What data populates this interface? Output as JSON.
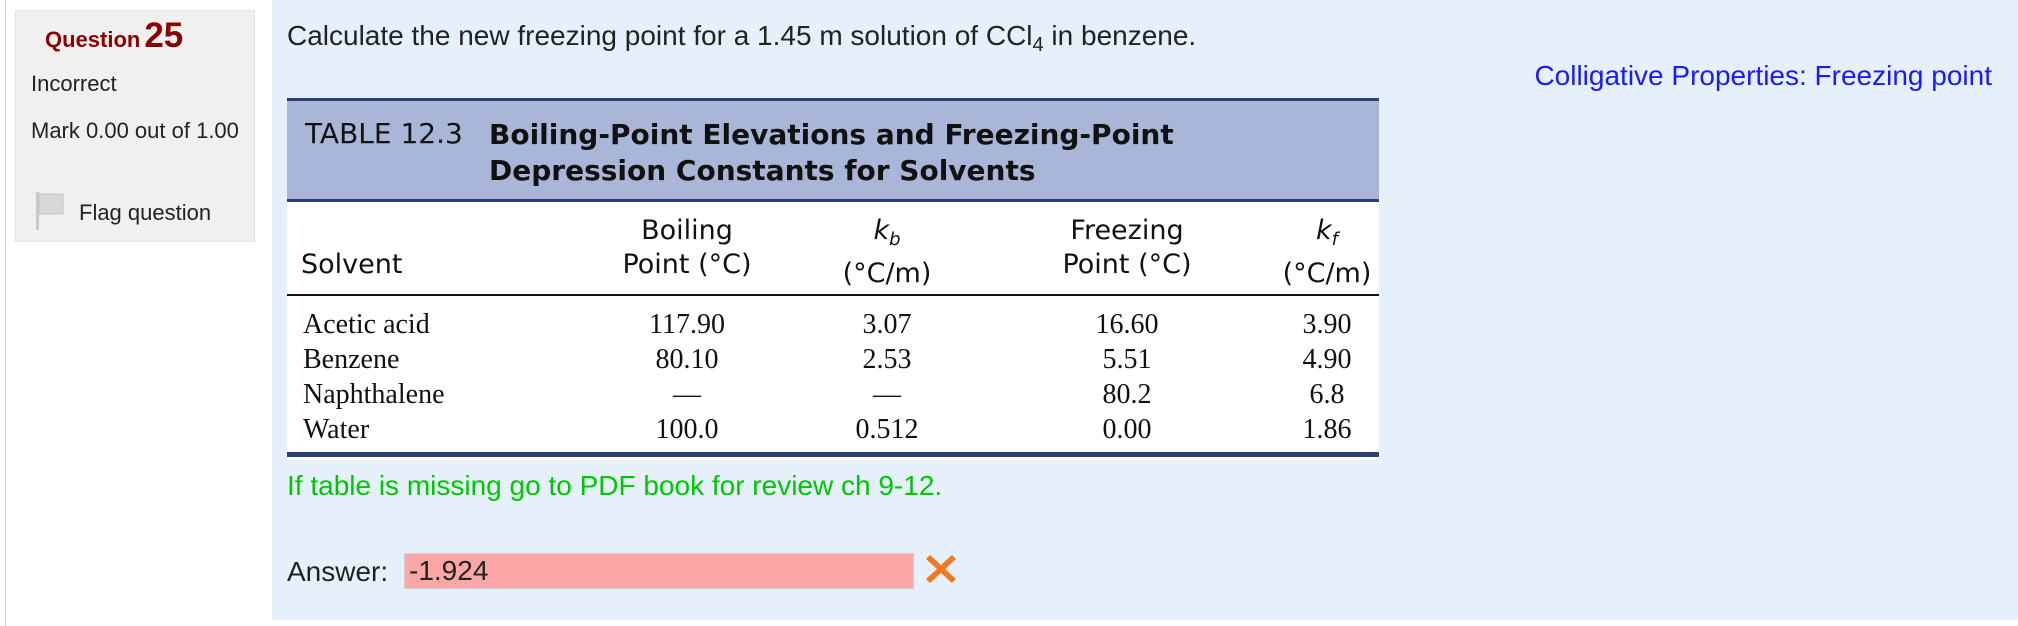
{
  "question_info": {
    "label": "Question",
    "number": "25",
    "state": "Incorrect",
    "grade": "Mark 0.00 out of 1.00",
    "flag_label": "Flag question"
  },
  "question": {
    "text_before": "Calculate the new freezing point for a 1.45 m solution of CCl",
    "subscript": "4",
    "text_after": " in benzene.",
    "topic_link": "Colligative Properties: Freezing point"
  },
  "textbook_table": {
    "number": "TABLE 12.3",
    "title": "Boiling-Point Elevations and Freezing-Point Depression Constants for Solvents",
    "headers": {
      "solvent": "Solvent",
      "bp_line1": "Boiling",
      "bp_line2": "Point (°C)",
      "kb_symbol": "k",
      "kb_sub": "b",
      "kb_unit": "(°C/m)",
      "fp_line1": "Freezing",
      "fp_line2": "Point (°C)",
      "kf_symbol": "k",
      "kf_sub": "f",
      "kf_unit": "(°C/m)"
    },
    "rows": [
      {
        "solvent": "Acetic acid",
        "bp": "117.90",
        "kb": "3.07",
        "fp": "16.60",
        "kf": "3.90"
      },
      {
        "solvent": "Benzene",
        "bp": "80.10",
        "kb": "2.53",
        "fp": "5.51",
        "kf": "4.90"
      },
      {
        "solvent": "Naphthalene",
        "bp": "—",
        "kb": "—",
        "fp": "80.2",
        "kf": "6.8"
      },
      {
        "solvent": "Water",
        "bp": "100.0",
        "kb": "0.512",
        "fp": "0.00",
        "kf": "1.86"
      }
    ]
  },
  "note": "If table is missing go to PDF book for review ch 9-12.",
  "answer": {
    "label": "Answer:",
    "value": "-1.924",
    "status_icon": "incorrect-x-icon"
  },
  "colors": {
    "link": "#1a1aff",
    "note": "#00c800",
    "incorrect_bg": "#fca7a7",
    "incorrect_icon": "#f07a1f",
    "question_number": "#8b0000"
  }
}
